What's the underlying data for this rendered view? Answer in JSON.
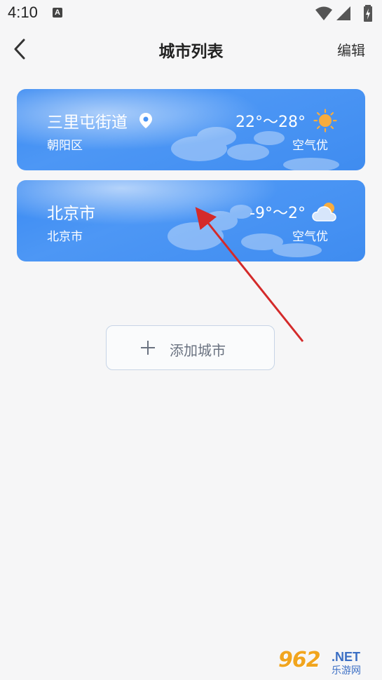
{
  "status_bar": {
    "time": "4:10",
    "notification_icon": "a-icon",
    "wifi_icon": "wifi-icon",
    "signal_icon": "signal-icon",
    "battery_icon": "battery-charging-icon"
  },
  "app_bar": {
    "back_icon": "chevron-left-icon",
    "title": "城市列表",
    "edit_label": "编辑"
  },
  "cities": [
    {
      "name": "三里屯街道",
      "district": "朝阳区",
      "temperature": "22°～28°",
      "air_quality": "空气优",
      "weather_icon": "sun-icon",
      "location_icon": "location-pin-icon"
    },
    {
      "name": "北京市",
      "district": "北京市",
      "temperature": "-9°～2°",
      "air_quality": "空气优",
      "weather_icon": "partly-cloudy-icon"
    }
  ],
  "add_city": {
    "icon": "plus-icon",
    "label": "添加城市"
  },
  "colors": {
    "card_blue": "#3f8cf0",
    "sun": "#f8ac3d",
    "annotation_arrow": "#d42a2a",
    "background": "#f6f6f7"
  },
  "watermark": {
    "brand": "962",
    "domain": ".NET",
    "name": "乐游网"
  }
}
